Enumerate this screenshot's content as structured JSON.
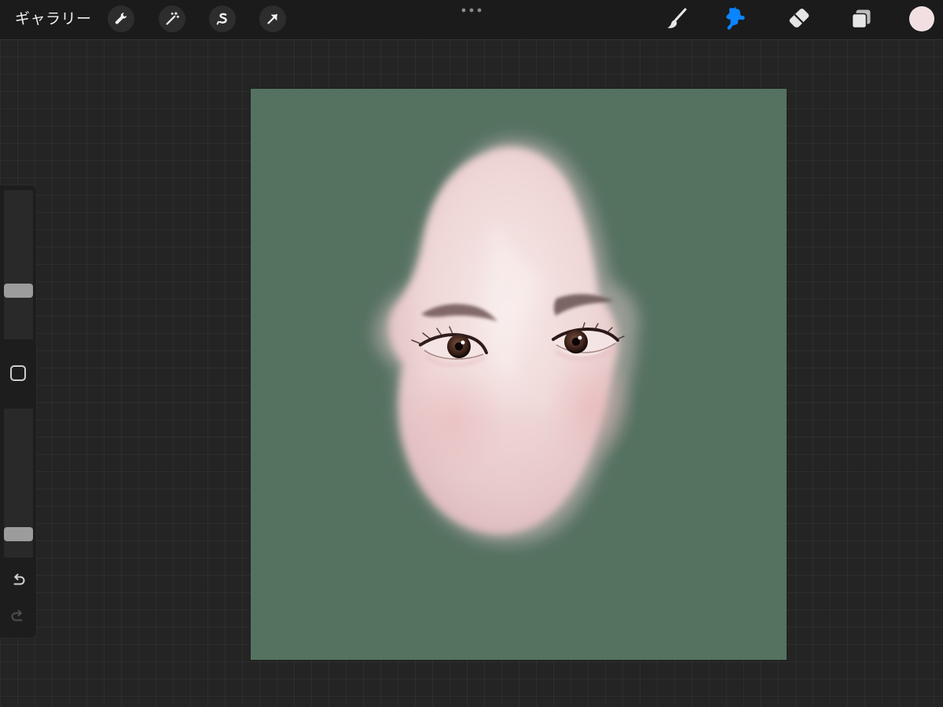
{
  "toolbar": {
    "gallery_label": "ギャラリー",
    "left_tools": [
      {
        "icon": "wrench-icon"
      },
      {
        "icon": "magic-wand-icon"
      },
      {
        "icon": "selection-s-icon"
      },
      {
        "icon": "transform-arrow-icon"
      }
    ],
    "more_icon": "more-dots-icon",
    "right_tools": [
      {
        "icon": "brush-icon",
        "active": false
      },
      {
        "icon": "smudge-icon",
        "active": true
      },
      {
        "icon": "eraser-icon",
        "active": false
      },
      {
        "icon": "layers-icon",
        "active": false
      }
    ],
    "current_color": "#F1DFE2",
    "active_tool_color": "#0A84FF"
  },
  "sidebar": {
    "brush_size_level": 0.31,
    "opacity_level": 0.12,
    "modifier_icon": "square-icon",
    "undo_icon": "undo-icon",
    "redo_icon": "redo-icon"
  },
  "canvas": {
    "background_color": "#557160",
    "artwork": "face-painting"
  }
}
